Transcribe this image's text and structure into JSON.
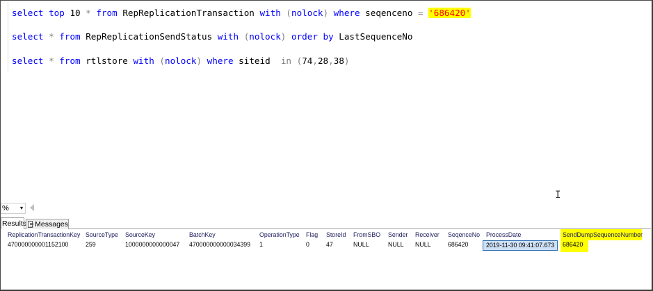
{
  "editor": {
    "lines": [
      {
        "parts": [
          {
            "t": "select",
            "c": "kw"
          },
          {
            "t": " ",
            "c": "obj"
          },
          {
            "t": "top",
            "c": "kw"
          },
          {
            "t": " ",
            "c": "obj"
          },
          {
            "t": "10",
            "c": "obj"
          },
          {
            "t": " ",
            "c": "obj"
          },
          {
            "t": "*",
            "c": "gray"
          },
          {
            "t": " ",
            "c": "obj"
          },
          {
            "t": "from",
            "c": "kw"
          },
          {
            "t": " RepReplicationTransaction ",
            "c": "obj"
          },
          {
            "t": "with",
            "c": "kw"
          },
          {
            "t": " ",
            "c": "obj"
          },
          {
            "t": "(",
            "c": "gray"
          },
          {
            "t": "nolock",
            "c": "kw"
          },
          {
            "t": ")",
            "c": "gray"
          },
          {
            "t": " ",
            "c": "obj"
          },
          {
            "t": "where",
            "c": "kw"
          },
          {
            "t": " seqenceno ",
            "c": "obj"
          },
          {
            "t": "=",
            "c": "gray"
          },
          {
            "t": " ",
            "c": "obj"
          },
          {
            "t": "'686420'",
            "c": "str hl"
          }
        ]
      },
      {
        "parts": [
          {
            "t": "select",
            "c": "kw"
          },
          {
            "t": " ",
            "c": "obj"
          },
          {
            "t": "*",
            "c": "gray"
          },
          {
            "t": " ",
            "c": "obj"
          },
          {
            "t": "from",
            "c": "kw"
          },
          {
            "t": " RepReplicationSendStatus ",
            "c": "obj"
          },
          {
            "t": "with",
            "c": "kw"
          },
          {
            "t": " ",
            "c": "obj"
          },
          {
            "t": "(",
            "c": "gray"
          },
          {
            "t": "nolock",
            "c": "kw"
          },
          {
            "t": ")",
            "c": "gray"
          },
          {
            "t": " ",
            "c": "obj"
          },
          {
            "t": "order",
            "c": "kw"
          },
          {
            "t": " ",
            "c": "obj"
          },
          {
            "t": "by",
            "c": "kw"
          },
          {
            "t": " LastSequenceNo",
            "c": "obj"
          }
        ]
      },
      {
        "parts": [
          {
            "t": "select",
            "c": "kw"
          },
          {
            "t": " ",
            "c": "obj"
          },
          {
            "t": "*",
            "c": "gray"
          },
          {
            "t": " ",
            "c": "obj"
          },
          {
            "t": "from",
            "c": "kw"
          },
          {
            "t": " rtlstore ",
            "c": "obj"
          },
          {
            "t": "with",
            "c": "kw"
          },
          {
            "t": " ",
            "c": "obj"
          },
          {
            "t": "(",
            "c": "gray"
          },
          {
            "t": "nolock",
            "c": "kw"
          },
          {
            "t": ")",
            "c": "gray"
          },
          {
            "t": " ",
            "c": "obj"
          },
          {
            "t": "where",
            "c": "kw"
          },
          {
            "t": " siteid  ",
            "c": "obj"
          },
          {
            "t": "in",
            "c": "gray"
          },
          {
            "t": " ",
            "c": "obj"
          },
          {
            "t": "(",
            "c": "gray"
          },
          {
            "t": "74",
            "c": "obj"
          },
          {
            "t": ",",
            "c": "gray"
          },
          {
            "t": "28",
            "c": "obj"
          },
          {
            "t": ",",
            "c": "gray"
          },
          {
            "t": "38",
            "c": "obj"
          },
          {
            "t": ")",
            "c": "gray"
          }
        ]
      }
    ]
  },
  "zoom": {
    "value": "%",
    "caret": "▾"
  },
  "tabs": {
    "results": "Results",
    "messages": "Messages"
  },
  "grid": {
    "columns": [
      "ReplicationTransactionKey",
      "SourceType",
      "SourceKey",
      "BatchKey",
      "OperationType",
      "Flag",
      "StoreId",
      "FromSBO",
      "Sender",
      "Receiver",
      "SeqenceNo",
      "ProcessDate",
      "SendDumpSequenceNumber"
    ],
    "row": [
      "470000000001152100",
      "259",
      "1000000000000047",
      "470000000000034399",
      "1",
      "0",
      "47",
      "NULL",
      "NULL",
      "NULL",
      "686420",
      "2019-11-30 09:41:07.673",
      "686420"
    ]
  },
  "cursor_glyph": "I"
}
